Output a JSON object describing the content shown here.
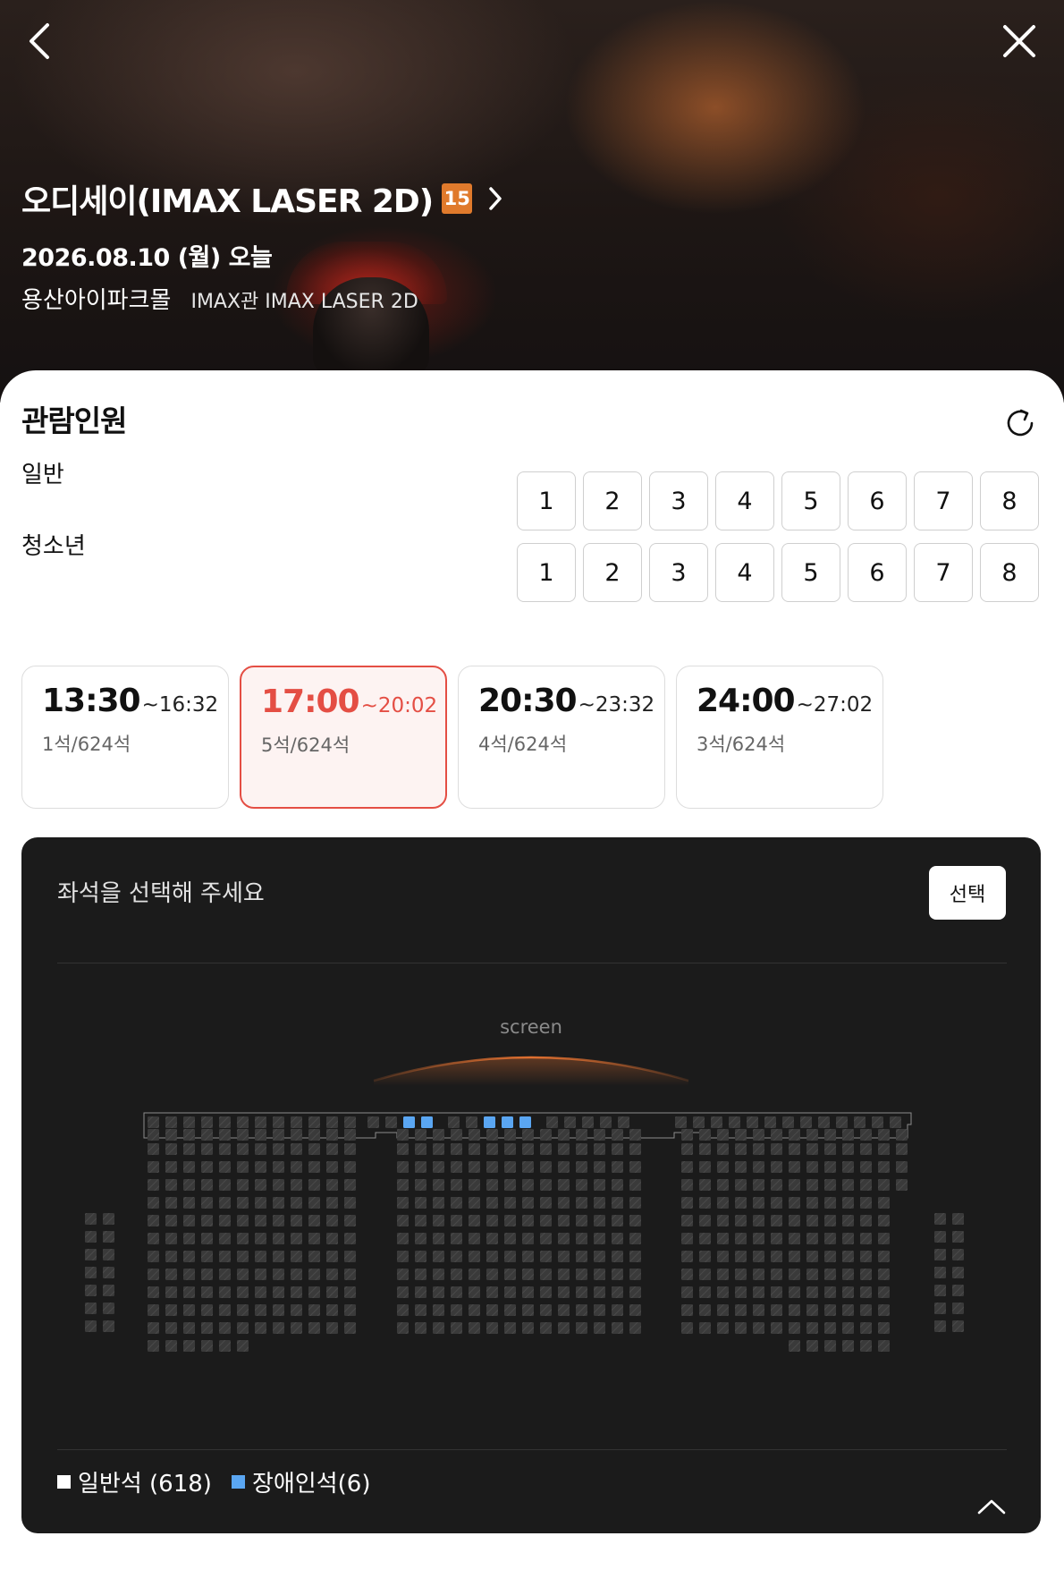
{
  "header": {
    "back_icon": "chevron-left-icon",
    "close_icon": "close-icon",
    "movie_title": "오디세이(IMAX LASER 2D)",
    "age_rating": "15",
    "date": "2026.08.10 (월) 오늘",
    "theater": "용산아이파크몰",
    "screen": "IMAX관 IMAX LASER 2D"
  },
  "audience": {
    "title": "관람인원",
    "rows": [
      {
        "label": "일반",
        "options": [
          "1",
          "2",
          "3",
          "4",
          "5",
          "6",
          "7",
          "8"
        ]
      },
      {
        "label": "청소년",
        "options": [
          "1",
          "2",
          "3",
          "4",
          "5",
          "6",
          "7",
          "8"
        ]
      }
    ]
  },
  "showtimes": [
    {
      "start": "13:30",
      "end": "~16:32",
      "seats": "1석/624석",
      "selected": false
    },
    {
      "start": "17:00",
      "end": "~20:02",
      "seats": "5석/624석",
      "selected": true
    },
    {
      "start": "20:30",
      "end": "~23:32",
      "seats": "4석/624석",
      "selected": false
    },
    {
      "start": "24:00",
      "end": "~27:02",
      "seats": "3석/624석",
      "selected": false
    }
  ],
  "seat_panel": {
    "guide": "좌석을 선택해 주세요",
    "select_button": "선택",
    "screen_label": "screen",
    "legend": [
      {
        "label": "일반석 (618)",
        "color": "#ffffff"
      },
      {
        "label": "장애인석(6)",
        "color": "#5aa6f2"
      }
    ]
  },
  "colors": {
    "accent": "#e44e44",
    "seat_unavailable": "#3a3a3a",
    "seat_accessible": "#5aa6f2",
    "panel_bg": "#1b1b1b"
  }
}
